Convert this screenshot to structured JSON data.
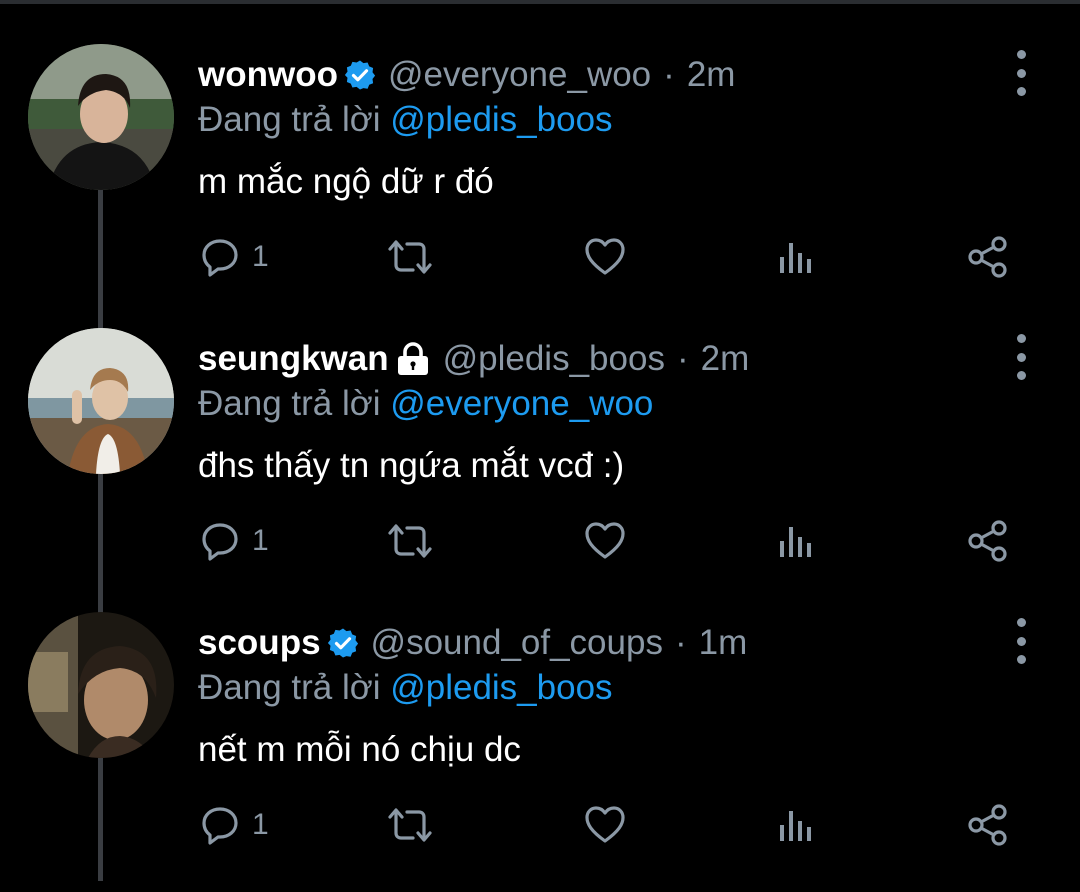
{
  "colors": {
    "background": "#000000",
    "text_secondary": "#8b98a5",
    "accent": "#1d9bf0"
  },
  "tweets": [
    {
      "name": "wonwoo",
      "badge": "verified-badge-icon",
      "handle": "@everyone_woo",
      "separator": "·",
      "time": "2m",
      "replying_prefix": "Đang trả lời",
      "replying_to": "@pledis_boos",
      "text": "m mắc ngộ dữ r đó",
      "reply_count": "1"
    },
    {
      "name": "seungkwan",
      "badge": "lock-icon",
      "handle": "@pledis_boos",
      "separator": "·",
      "time": "2m",
      "replying_prefix": "Đang trả lời",
      "replying_to": "@everyone_woo",
      "text": "đhs thấy tn ngứa mắt vcđ :)",
      "reply_count": "1"
    },
    {
      "name": "scoups",
      "badge": "verified-badge-icon",
      "handle": "@sound_of_coups",
      "separator": "·",
      "time": "1m",
      "replying_prefix": "Đang trả lời",
      "replying_to": "@pledis_boos",
      "text": "nết m mỗi nó chịu dc",
      "reply_count": "1"
    }
  ],
  "action_icons": [
    "reply-icon",
    "retweet-icon",
    "like-icon",
    "analytics-icon",
    "share-icon"
  ]
}
